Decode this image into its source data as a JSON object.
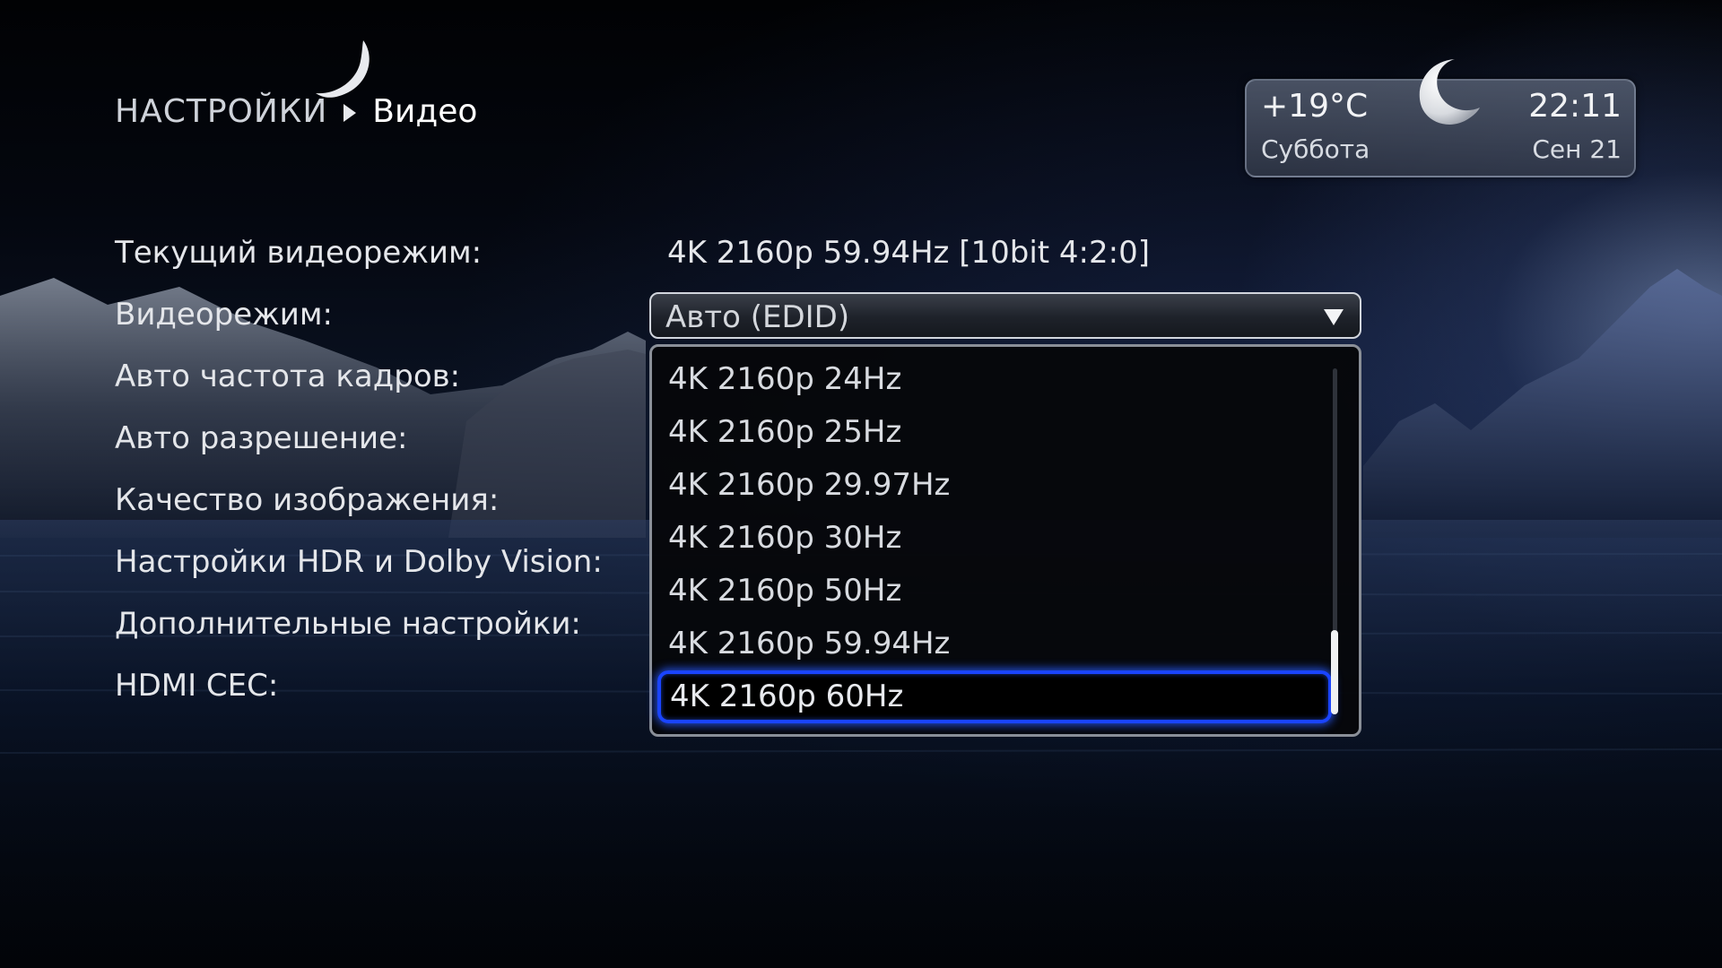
{
  "breadcrumb": {
    "root": "НАСТРОЙКИ",
    "current": "Видео"
  },
  "weather": {
    "temperature": "+19°C",
    "time": "22:11",
    "day": "Суббота",
    "date": "Сен 21",
    "icon": "crescent-moon-icon"
  },
  "settings": {
    "current_mode_label": "Текущий видеорежим:",
    "current_mode_value": "4K 2160p 59.94Hz [10bit 4:2:0]",
    "video_mode_label": "Видеорежим:",
    "auto_frame_rate_label": "Авто частота кадров:",
    "auto_resolution_label": "Авто разрешение:",
    "picture_quality_label": "Качество изображения:",
    "hdr_label": "Настройки HDR и Dolby Vision:",
    "advanced_label": "Дополнительные настройки:",
    "hdmi_cec_label": "HDMI CEC:"
  },
  "video_mode_dropdown": {
    "selected_value": "Авто (EDID)",
    "options": [
      "4K 2160p 24Hz",
      "4K 2160p 25Hz",
      "4K 2160p 29.97Hz",
      "4K 2160p 30Hz",
      "4K 2160p 50Hz",
      "4K 2160p 59.94Hz",
      "4K 2160p 60Hz"
    ],
    "highlighted_option": "4K 2160p 60Hz"
  },
  "colors": {
    "highlight_border": "#1a44ff",
    "text": "#e4e6ea",
    "background": "#04070f"
  }
}
